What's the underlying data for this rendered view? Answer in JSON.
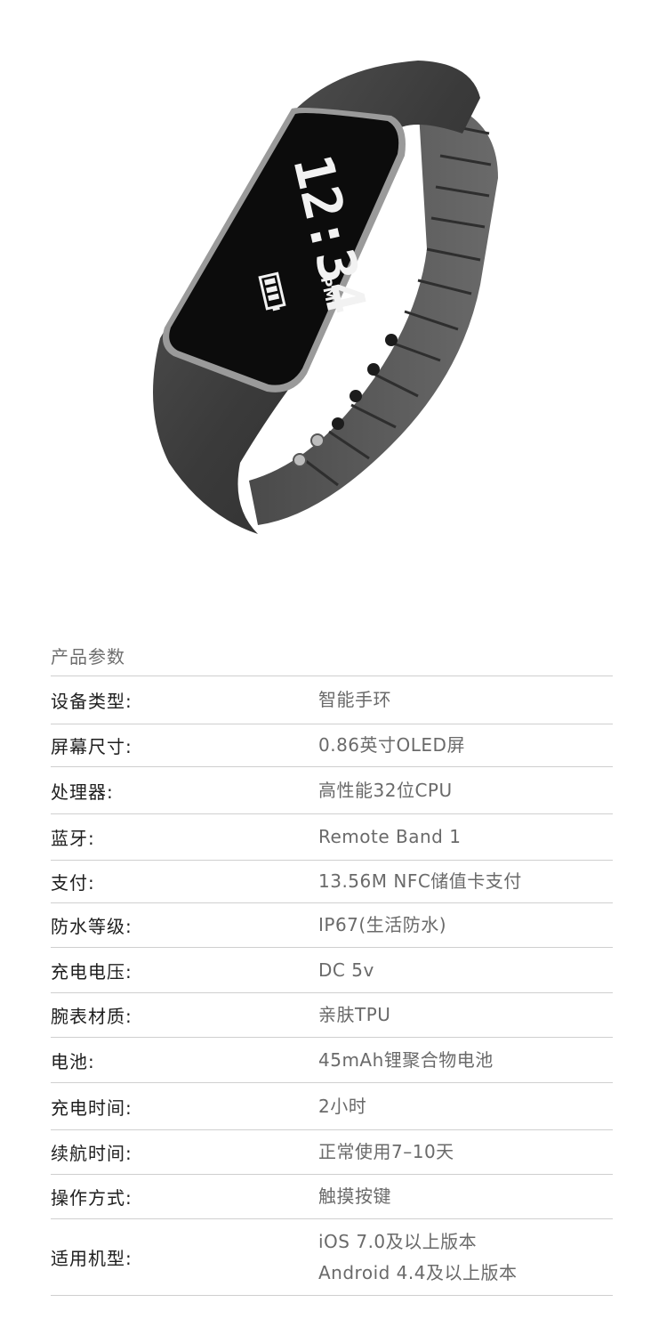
{
  "product": {
    "screen_time": "12:34",
    "screen_ampm": "PM"
  },
  "specs": {
    "title": "产品参数",
    "rows": [
      {
        "label": "设备类型:",
        "value": [
          "智能手环"
        ]
      },
      {
        "label": "屏幕尺寸:",
        "value": [
          "0.86英寸OLED屏"
        ]
      },
      {
        "label": "处理器:",
        "value": [
          "高性能32位CPU"
        ]
      },
      {
        "label": "蓝牙:",
        "value": [
          "Remote  Band 1"
        ]
      },
      {
        "label": "支付:",
        "value": [
          "13.56M NFC储值卡支付"
        ]
      },
      {
        "label": "防水等级:",
        "value": [
          "IP67(生活防水)"
        ]
      },
      {
        "label": "充电电压:",
        "value": [
          "DC 5v"
        ]
      },
      {
        "label": "腕表材质:",
        "value": [
          "亲肤TPU"
        ]
      },
      {
        "label": "电池:",
        "value": [
          "45mAh锂聚合物电池"
        ]
      },
      {
        "label": "充电时间:",
        "value": [
          "2小时"
        ]
      },
      {
        "label": "续航时间:",
        "value": [
          "正常使用7–10天"
        ]
      },
      {
        "label": "操作方式:",
        "value": [
          "触摸按键"
        ]
      },
      {
        "label": "适用机型:",
        "value": [
          "iOS 7.0及以上版本",
          "Android 4.4及以上版本"
        ]
      }
    ]
  }
}
